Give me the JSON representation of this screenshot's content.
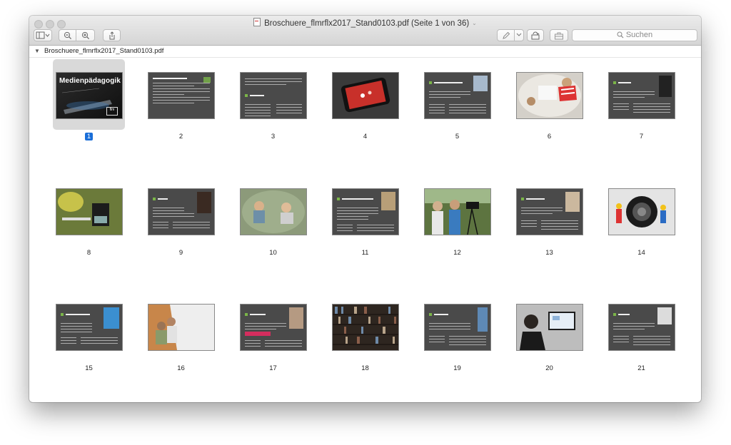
{
  "window": {
    "title": "Broschuere_flmrflx2017_Stand0103.pdf (Seite 1 von 36)"
  },
  "toolbar": {
    "search_placeholder": "Suchen"
  },
  "sidebar": {
    "document_name": "Broschuere_flmrflx2017_Stand0103.pdf",
    "selected_page": "1",
    "cover_title": "Medienpädagogik",
    "pages": [
      {
        "number": "1"
      },
      {
        "number": "2"
      },
      {
        "number": "3"
      },
      {
        "number": "4"
      },
      {
        "number": "5"
      },
      {
        "number": "6"
      },
      {
        "number": "7"
      },
      {
        "number": "8"
      },
      {
        "number": "9"
      },
      {
        "number": "10"
      },
      {
        "number": "11"
      },
      {
        "number": "12"
      },
      {
        "number": "13"
      },
      {
        "number": "14"
      },
      {
        "number": "15"
      },
      {
        "number": "16"
      },
      {
        "number": "17"
      },
      {
        "number": "18"
      },
      {
        "number": "19"
      },
      {
        "number": "20"
      },
      {
        "number": "21"
      }
    ]
  },
  "colors": {
    "selection_accent": "#1a6ed8",
    "slide_background": "#4a4a4a",
    "accent_green": "#7bb548"
  }
}
